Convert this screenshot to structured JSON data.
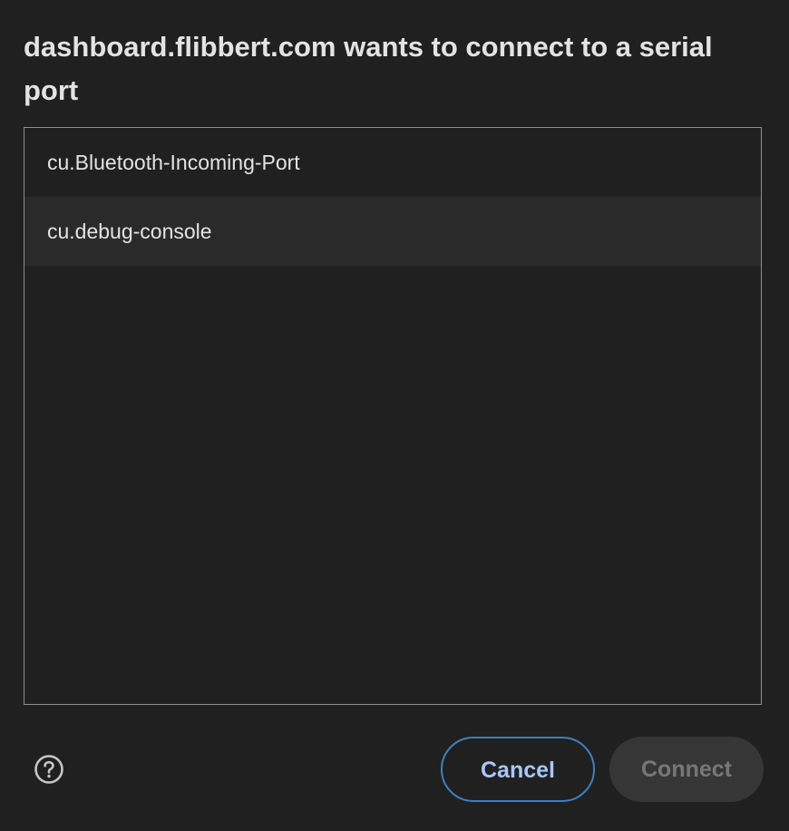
{
  "dialog": {
    "title": "dashboard.flibbert.com wants to connect to a serial port"
  },
  "ports": [
    {
      "label": "cu.Bluetooth-Incoming-Port",
      "selected": false
    },
    {
      "label": "cu.debug-console",
      "selected": true
    }
  ],
  "footer": {
    "help_icon": "help-circle-icon",
    "cancel_label": "Cancel",
    "connect_label": "Connect",
    "connect_enabled": false
  },
  "colors": {
    "background": "#202020",
    "accent": "#a8c7fa",
    "cancel_border": "#3d7fc1",
    "disabled_button_bg": "#363636",
    "disabled_button_text": "#777777"
  }
}
